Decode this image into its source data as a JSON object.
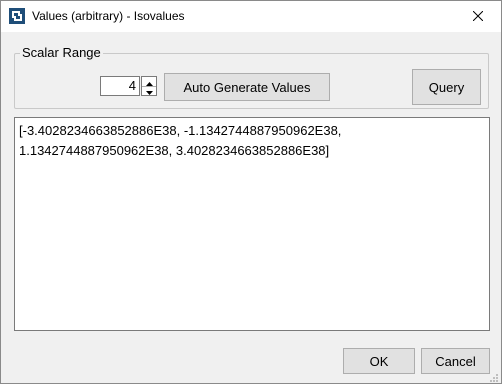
{
  "window": {
    "title": "Values (arbitrary) - Isovalues",
    "app_icon": "paraview-logo-icon",
    "close_icon": "close-icon"
  },
  "scalar_range": {
    "label": "Scalar Range",
    "count_value": "4",
    "spin_up_icon": "chevron-up-icon",
    "spin_down_icon": "chevron-down-icon",
    "auto_generate_label": "Auto Generate Values",
    "query_label": "Query"
  },
  "values_text": "[-3.4028234663852886E38, -1.1342744887950962E38,\n1.1342744887950962E38, 3.4028234663852886E38]",
  "footer": {
    "ok_label": "OK",
    "cancel_label": "Cancel"
  }
}
